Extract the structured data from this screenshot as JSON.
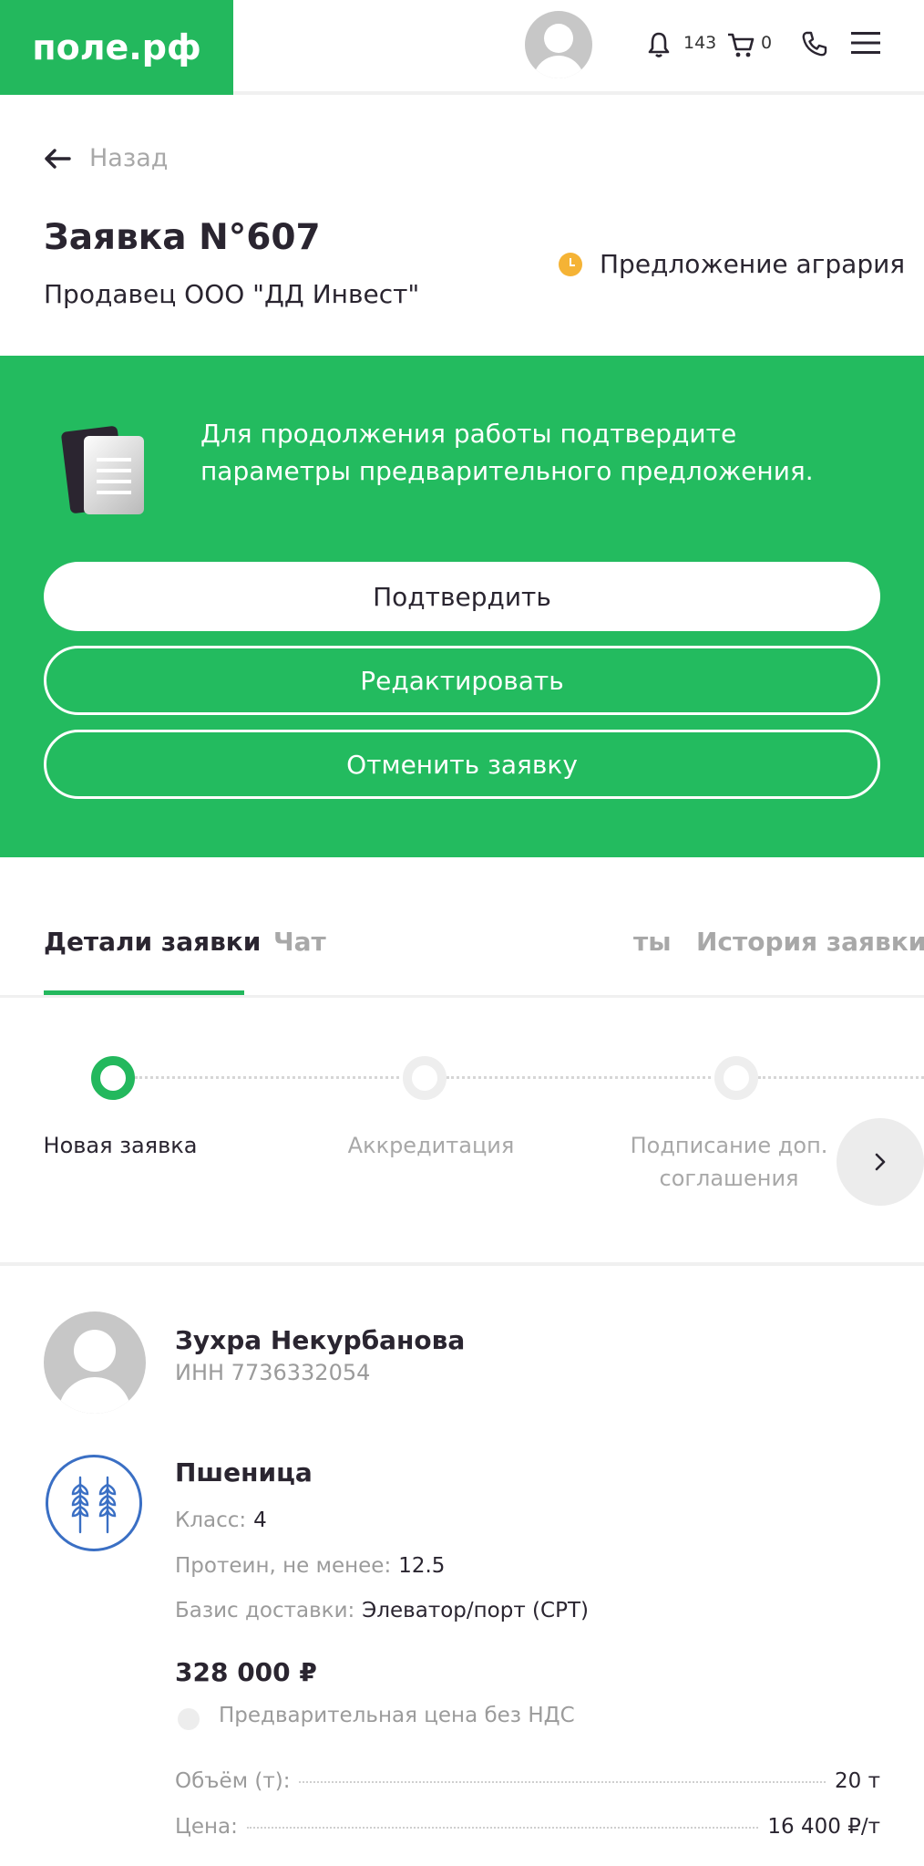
{
  "header": {
    "logo": "поле.рф",
    "notifications_count": "143",
    "cart_count": "0",
    "brand_color": "#23b85d"
  },
  "back_label": "Назад",
  "order": {
    "title": "Заявка N°607",
    "seller": "Продавец ООО \"ДД Инвест\"",
    "status": "Предложение агрария",
    "status_color": "#f5b335"
  },
  "confirm_panel": {
    "message": "Для продолжения работы подтвердите параметры предварительного предложения.",
    "confirm_label": "Подтвердить",
    "edit_label": "Редактировать",
    "cancel_label": "Отменить заявку"
  },
  "tabs": [
    {
      "label": "Детали заявки",
      "active": true
    },
    {
      "label": "Чат",
      "active": false
    },
    {
      "label": "ты",
      "active": false
    },
    {
      "label": "История заявки",
      "active": false
    }
  ],
  "steps": [
    {
      "label": "Новая заявка",
      "state": "done"
    },
    {
      "label": "Аккредитация",
      "state": "todo"
    },
    {
      "label": "Подписание доп. соглашения",
      "state": "todo"
    }
  ],
  "user": {
    "name": "Зухра Некурбанова",
    "inn": "ИНН 7736332054"
  },
  "crop": {
    "name": "Пшеница",
    "icon": "wheat-icon",
    "params": [
      {
        "key": "Класс:",
        "value": "4"
      },
      {
        "key": "Протеин, не менее:",
        "value": "12.5"
      },
      {
        "key": "Базис доставки:",
        "value": "Элеватор/порт (CPT)"
      }
    ],
    "price": "328 000 ₽",
    "price_note": "Предварительная цена без НДС",
    "rows": [
      {
        "key": "Объём (т):",
        "value": "20 т"
      },
      {
        "key": "Цена:",
        "value": "16 400 ₽/т"
      }
    ]
  }
}
